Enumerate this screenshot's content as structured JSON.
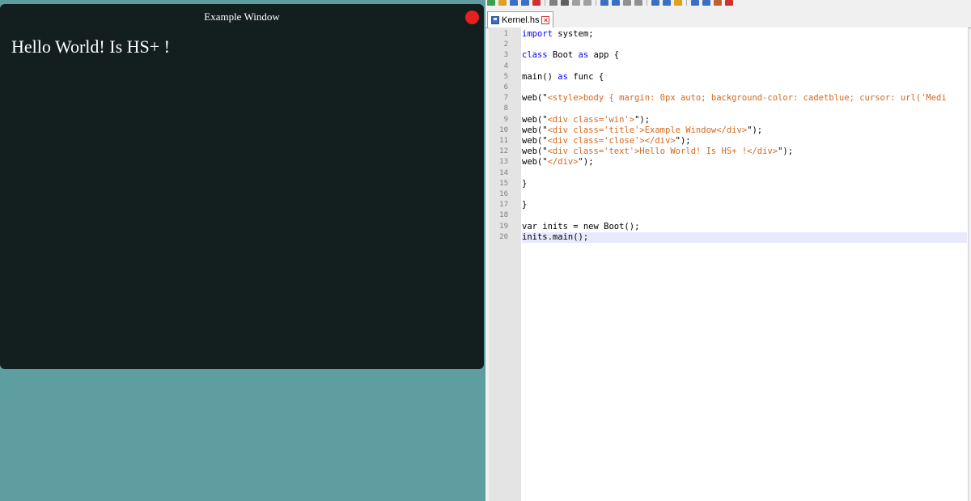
{
  "window": {
    "title": "Example Window",
    "text": "Hello World! Is HS+ !",
    "close_color": "#e81f1f",
    "background": "#131f1f",
    "page_background": "#5f9ea0"
  },
  "editor": {
    "tab": {
      "label": "Kernel.hs",
      "close_icon": "close-x-icon",
      "file_icon": "save-icon"
    },
    "current_line": 20,
    "lines": [
      {
        "n": "1",
        "tokens": [
          {
            "t": "import",
            "c": "kw"
          },
          {
            "t": " system;",
            "c": ""
          }
        ]
      },
      {
        "n": "2",
        "tokens": []
      },
      {
        "n": "3",
        "tokens": [
          {
            "t": "class",
            "c": "kw"
          },
          {
            "t": " Boot ",
            "c": ""
          },
          {
            "t": "as",
            "c": "kw"
          },
          {
            "t": " app {",
            "c": ""
          }
        ]
      },
      {
        "n": "4",
        "tokens": []
      },
      {
        "n": "5",
        "tokens": [
          {
            "t": "main() ",
            "c": ""
          },
          {
            "t": "as",
            "c": "kw"
          },
          {
            "t": " func {",
            "c": ""
          }
        ]
      },
      {
        "n": "6",
        "tokens": []
      },
      {
        "n": "7",
        "tokens": [
          {
            "t": "web(\"",
            "c": ""
          },
          {
            "t": "<style>body { margin: 0px auto; background-color: cadetblue; cursor: url('Medi",
            "c": "str"
          }
        ]
      },
      {
        "n": "8",
        "tokens": []
      },
      {
        "n": "9",
        "tokens": [
          {
            "t": "web(\"",
            "c": ""
          },
          {
            "t": "<div class='win'>",
            "c": "str"
          },
          {
            "t": "\");",
            "c": ""
          }
        ]
      },
      {
        "n": "10",
        "tokens": [
          {
            "t": "web(\"",
            "c": ""
          },
          {
            "t": "<div class='title'>Example Window</div>",
            "c": "str"
          },
          {
            "t": "\");",
            "c": ""
          }
        ]
      },
      {
        "n": "11",
        "tokens": [
          {
            "t": "web(\"",
            "c": ""
          },
          {
            "t": "<div class='close'></div>",
            "c": "str"
          },
          {
            "t": "\");",
            "c": ""
          }
        ]
      },
      {
        "n": "12",
        "tokens": [
          {
            "t": "web(\"",
            "c": ""
          },
          {
            "t": "<div class='text'>Hello World! Is HS+ !</div>",
            "c": "str"
          },
          {
            "t": "\");",
            "c": ""
          }
        ]
      },
      {
        "n": "13",
        "tokens": [
          {
            "t": "web(\"",
            "c": ""
          },
          {
            "t": "</div>",
            "c": "str"
          },
          {
            "t": "\");",
            "c": ""
          }
        ]
      },
      {
        "n": "14",
        "tokens": []
      },
      {
        "n": "15",
        "tokens": [
          {
            "t": "}",
            "c": ""
          }
        ]
      },
      {
        "n": "16",
        "tokens": []
      },
      {
        "n": "17",
        "tokens": [
          {
            "t": "}",
            "c": ""
          }
        ]
      },
      {
        "n": "18",
        "tokens": []
      },
      {
        "n": "19",
        "tokens": [
          {
            "t": "var inits = new Boot();",
            "c": ""
          }
        ]
      },
      {
        "n": "20",
        "tokens": [
          {
            "t": "inits.main();",
            "c": ""
          }
        ]
      }
    ]
  },
  "toolbar_icons": [
    "new-icon",
    "open-icon",
    "save-icon",
    "save-all-icon",
    "close-icon",
    "print-icon",
    "cut-icon",
    "copy-icon",
    "paste-icon",
    "undo-icon",
    "redo-icon",
    "find-icon",
    "replace-icon",
    "zoom-in-icon",
    "zoom-out-icon",
    "sync-icon",
    "wrap-icon",
    "indent-icon",
    "macro-icon",
    "run-icon"
  ]
}
